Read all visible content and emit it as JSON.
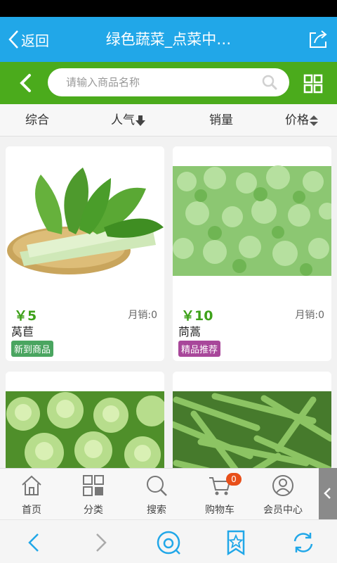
{
  "header": {
    "back_label": "返回",
    "title": "绿色蔬菜_点菜中…"
  },
  "search": {
    "placeholder": "请输入商品名称"
  },
  "sort_options": [
    "综合",
    "人气",
    "销量",
    "价格"
  ],
  "products": [
    {
      "price": "￥5",
      "sales": "月销:0",
      "name": "莴苣",
      "tag": "新到商品",
      "tag_color": "#4aa560"
    },
    {
      "price": "￥10",
      "sales": "月销:0",
      "name": "茼蒿",
      "tag": "精品推荐",
      "tag_color": "#a8479a"
    },
    {
      "price": "",
      "sales": "",
      "name": "",
      "tag": ""
    },
    {
      "price": "",
      "sales": "",
      "name": "",
      "tag": ""
    }
  ],
  "tabbar": {
    "items": [
      {
        "label": "首页",
        "icon": "home-icon"
      },
      {
        "label": "分类",
        "icon": "category-icon"
      },
      {
        "label": "搜索",
        "icon": "search-icon"
      },
      {
        "label": "购物车",
        "icon": "cart-icon"
      },
      {
        "label": "会员中心",
        "icon": "member-icon"
      }
    ],
    "cart_count": "0"
  },
  "colors": {
    "header": "#21a7e8",
    "search_bar": "#4bab1c",
    "price": "#3ea11a"
  }
}
